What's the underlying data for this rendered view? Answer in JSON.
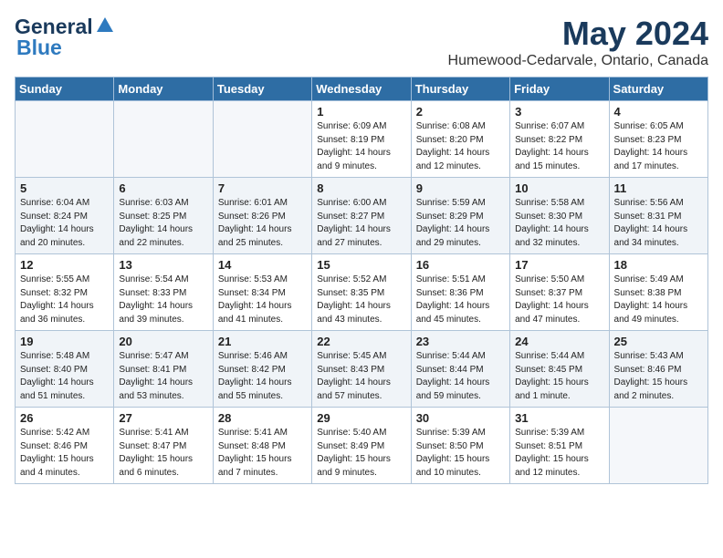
{
  "header": {
    "logo_line1": "General",
    "logo_line2": "Blue",
    "month": "May 2024",
    "location": "Humewood-Cedarvale, Ontario, Canada"
  },
  "days_of_week": [
    "Sunday",
    "Monday",
    "Tuesday",
    "Wednesday",
    "Thursday",
    "Friday",
    "Saturday"
  ],
  "weeks": [
    [
      {
        "num": "",
        "info": ""
      },
      {
        "num": "",
        "info": ""
      },
      {
        "num": "",
        "info": ""
      },
      {
        "num": "1",
        "info": "Sunrise: 6:09 AM\nSunset: 8:19 PM\nDaylight: 14 hours\nand 9 minutes."
      },
      {
        "num": "2",
        "info": "Sunrise: 6:08 AM\nSunset: 8:20 PM\nDaylight: 14 hours\nand 12 minutes."
      },
      {
        "num": "3",
        "info": "Sunrise: 6:07 AM\nSunset: 8:22 PM\nDaylight: 14 hours\nand 15 minutes."
      },
      {
        "num": "4",
        "info": "Sunrise: 6:05 AM\nSunset: 8:23 PM\nDaylight: 14 hours\nand 17 minutes."
      }
    ],
    [
      {
        "num": "5",
        "info": "Sunrise: 6:04 AM\nSunset: 8:24 PM\nDaylight: 14 hours\nand 20 minutes."
      },
      {
        "num": "6",
        "info": "Sunrise: 6:03 AM\nSunset: 8:25 PM\nDaylight: 14 hours\nand 22 minutes."
      },
      {
        "num": "7",
        "info": "Sunrise: 6:01 AM\nSunset: 8:26 PM\nDaylight: 14 hours\nand 25 minutes."
      },
      {
        "num": "8",
        "info": "Sunrise: 6:00 AM\nSunset: 8:27 PM\nDaylight: 14 hours\nand 27 minutes."
      },
      {
        "num": "9",
        "info": "Sunrise: 5:59 AM\nSunset: 8:29 PM\nDaylight: 14 hours\nand 29 minutes."
      },
      {
        "num": "10",
        "info": "Sunrise: 5:58 AM\nSunset: 8:30 PM\nDaylight: 14 hours\nand 32 minutes."
      },
      {
        "num": "11",
        "info": "Sunrise: 5:56 AM\nSunset: 8:31 PM\nDaylight: 14 hours\nand 34 minutes."
      }
    ],
    [
      {
        "num": "12",
        "info": "Sunrise: 5:55 AM\nSunset: 8:32 PM\nDaylight: 14 hours\nand 36 minutes."
      },
      {
        "num": "13",
        "info": "Sunrise: 5:54 AM\nSunset: 8:33 PM\nDaylight: 14 hours\nand 39 minutes."
      },
      {
        "num": "14",
        "info": "Sunrise: 5:53 AM\nSunset: 8:34 PM\nDaylight: 14 hours\nand 41 minutes."
      },
      {
        "num": "15",
        "info": "Sunrise: 5:52 AM\nSunset: 8:35 PM\nDaylight: 14 hours\nand 43 minutes."
      },
      {
        "num": "16",
        "info": "Sunrise: 5:51 AM\nSunset: 8:36 PM\nDaylight: 14 hours\nand 45 minutes."
      },
      {
        "num": "17",
        "info": "Sunrise: 5:50 AM\nSunset: 8:37 PM\nDaylight: 14 hours\nand 47 minutes."
      },
      {
        "num": "18",
        "info": "Sunrise: 5:49 AM\nSunset: 8:38 PM\nDaylight: 14 hours\nand 49 minutes."
      }
    ],
    [
      {
        "num": "19",
        "info": "Sunrise: 5:48 AM\nSunset: 8:40 PM\nDaylight: 14 hours\nand 51 minutes."
      },
      {
        "num": "20",
        "info": "Sunrise: 5:47 AM\nSunset: 8:41 PM\nDaylight: 14 hours\nand 53 minutes."
      },
      {
        "num": "21",
        "info": "Sunrise: 5:46 AM\nSunset: 8:42 PM\nDaylight: 14 hours\nand 55 minutes."
      },
      {
        "num": "22",
        "info": "Sunrise: 5:45 AM\nSunset: 8:43 PM\nDaylight: 14 hours\nand 57 minutes."
      },
      {
        "num": "23",
        "info": "Sunrise: 5:44 AM\nSunset: 8:44 PM\nDaylight: 14 hours\nand 59 minutes."
      },
      {
        "num": "24",
        "info": "Sunrise: 5:44 AM\nSunset: 8:45 PM\nDaylight: 15 hours\nand 1 minute."
      },
      {
        "num": "25",
        "info": "Sunrise: 5:43 AM\nSunset: 8:46 PM\nDaylight: 15 hours\nand 2 minutes."
      }
    ],
    [
      {
        "num": "26",
        "info": "Sunrise: 5:42 AM\nSunset: 8:46 PM\nDaylight: 15 hours\nand 4 minutes."
      },
      {
        "num": "27",
        "info": "Sunrise: 5:41 AM\nSunset: 8:47 PM\nDaylight: 15 hours\nand 6 minutes."
      },
      {
        "num": "28",
        "info": "Sunrise: 5:41 AM\nSunset: 8:48 PM\nDaylight: 15 hours\nand 7 minutes."
      },
      {
        "num": "29",
        "info": "Sunrise: 5:40 AM\nSunset: 8:49 PM\nDaylight: 15 hours\nand 9 minutes."
      },
      {
        "num": "30",
        "info": "Sunrise: 5:39 AM\nSunset: 8:50 PM\nDaylight: 15 hours\nand 10 minutes."
      },
      {
        "num": "31",
        "info": "Sunrise: 5:39 AM\nSunset: 8:51 PM\nDaylight: 15 hours\nand 12 minutes."
      },
      {
        "num": "",
        "info": ""
      }
    ]
  ]
}
